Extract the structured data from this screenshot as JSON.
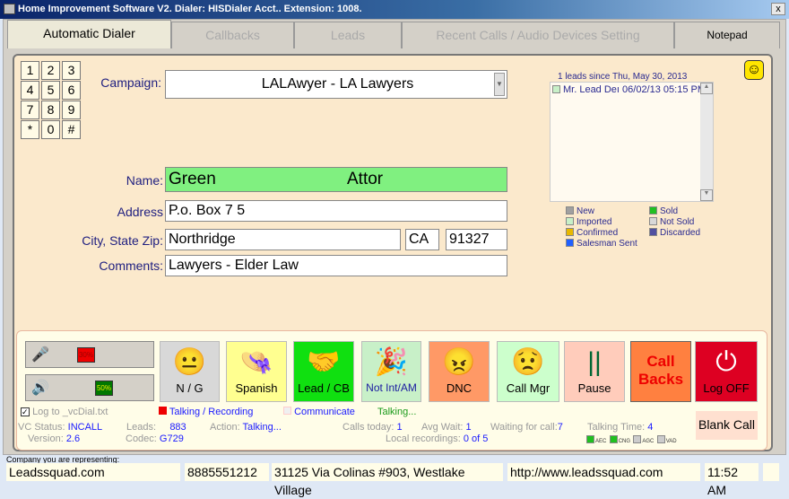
{
  "window": {
    "title": "Home Improvement Software V2. Dialer: HISDialer Acct.. Extension: 1008.",
    "close": "x"
  },
  "tabs": [
    {
      "label": "Automatic Dialer"
    },
    {
      "label": "Callbacks"
    },
    {
      "label": "Leads"
    },
    {
      "label": "Recent Calls / Audio Devices Setting"
    },
    {
      "label": "Notepad"
    }
  ],
  "keypad": [
    "1",
    "2",
    "3",
    "4",
    "5",
    "6",
    "7",
    "8",
    "9",
    "*",
    "0",
    "#"
  ],
  "form": {
    "campaign_label": "Campaign:",
    "campaign_value": "LALAwyer - LA Lawyers",
    "name_label": "Name:",
    "first_name": "Green",
    "last_name": "Attor",
    "address_label": "Address",
    "address": "P.o. Box 7     5",
    "city_label": "City, State Zip:",
    "city": "Northridge",
    "state": "CA",
    "zip": "91327",
    "comments_label": "Comments:",
    "comments": "Lawyers - Elder Law"
  },
  "leads": {
    "header": "1 leads since Thu, May 30, 2013",
    "items": [
      {
        "text": "Mr. Lead Deı 06/02/13 05:15 PM"
      }
    ],
    "legend": [
      {
        "label": "New",
        "color": "#a0a0a0"
      },
      {
        "label": "Sold",
        "color": "#20c020"
      },
      {
        "label": "Imported",
        "color": "#c8f0c8"
      },
      {
        "label": "Not Sold",
        "color": "#d8d8d8"
      },
      {
        "label": "Confirmed",
        "color": "#e8b800"
      },
      {
        "label": "Discarded",
        "color": "#5050a0"
      },
      {
        "label": "Salesman Sent",
        "color": "#2060ff"
      }
    ]
  },
  "audio": {
    "mic_level": "30%",
    "speaker_level": "50%"
  },
  "buttons": [
    {
      "label": "N / G",
      "bg": "#d8d8d8"
    },
    {
      "label": "Spanish",
      "bg": "#ffff90"
    },
    {
      "label": "Lead / CB",
      "bg": "#10e010"
    },
    {
      "label": "Not Int/AM",
      "bg": "#c8f0c8"
    },
    {
      "label": "DNC",
      "bg": "#ff9966"
    },
    {
      "label": "Call Mgr",
      "bg": "#ccffcc"
    },
    {
      "label": "Pause",
      "bg": "#ffccbb"
    },
    {
      "label": "Call Backs",
      "bg": "#ff8040"
    },
    {
      "label": "Log OFF",
      "bg": "#dd0022"
    }
  ],
  "blank_call": "Blank Call",
  "status": {
    "log_label": "Log to _vcDial.txt",
    "log_checked": true,
    "talking_recording": "Talking / Recording",
    "communicate": "Communicate",
    "talking": "Talking...",
    "vc_status_label": "VC Status:",
    "vc_status": "INCALL",
    "version_label": "Version:",
    "version": "2.6",
    "leads_label": "Leads:",
    "leads": "883",
    "codec_label": "Codec:",
    "codec": "G729",
    "action_label": "Action:",
    "action": "Talking...",
    "calls_today_label": "Calls today:",
    "calls_today": "1",
    "avg_wait_label": "Avg Wait:",
    "avg_wait": "1",
    "waiting_label": "Waiting for call:",
    "waiting": "7",
    "local_rec_label": "Local recordings:",
    "local_rec": "0 of 5",
    "talking_time_label": "Talking Time:",
    "talking_time": "4",
    "indicators": [
      {
        "label": "AEC",
        "on": true
      },
      {
        "label": "CNG",
        "on": true
      },
      {
        "label": "AGC",
        "on": false
      },
      {
        "label": "VAD",
        "on": false
      }
    ]
  },
  "footer": {
    "company_label": "Company you are representing:",
    "company": "Leadssquad.com",
    "phone": "8885551212",
    "address": "31125 Via Colinas #903, Westlake Village",
    "url": "http://www.leadssquad.com",
    "time": "11:52 AM"
  }
}
